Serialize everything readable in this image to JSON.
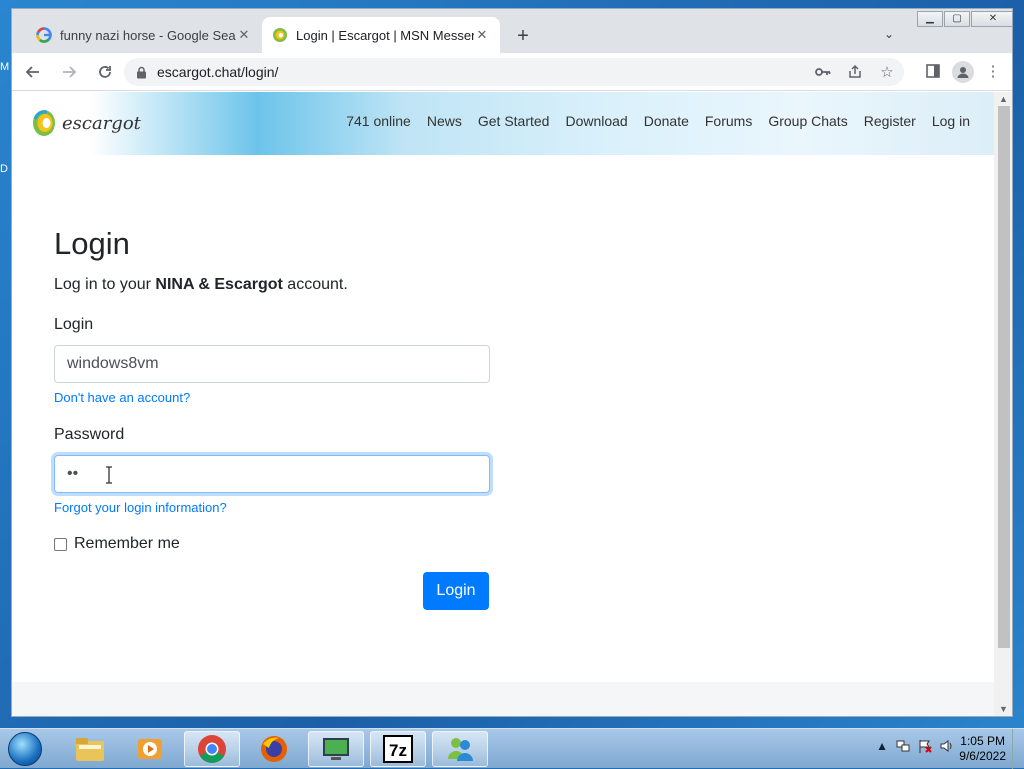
{
  "desktop": {
    "edge_letters": [
      "M",
      "D"
    ]
  },
  "browser": {
    "tabs": [
      {
        "title": "funny nazi horse - Google Search",
        "favicon": "google-g-icon",
        "active": false
      },
      {
        "title": "Login | Escargot | MSN Messenger",
        "favicon": "escargot-icon",
        "active": true
      }
    ],
    "address": "escargot.chat/login/"
  },
  "site": {
    "logo_text": "escargot",
    "nav": [
      "741 online",
      "News",
      "Get Started",
      "Download",
      "Donate",
      "Forums",
      "Group Chats",
      "Register",
      "Log in"
    ]
  },
  "form": {
    "heading": "Login",
    "lead_prefix": "Log in to your ",
    "lead_bold": "NINA & Escargot",
    "lead_suffix": " account.",
    "login_label": "Login",
    "login_value": "windows8vm",
    "no_account_link": "Don't have an account?",
    "password_label": "Password",
    "password_value": "••",
    "forgot_link": "Forgot your login information?",
    "remember_label": "Remember me",
    "submit_label": "Login"
  },
  "taskbar": {
    "time": "1:05 PM",
    "date": "9/6/2022"
  },
  "colors": {
    "primary": "#007bff",
    "link": "#007bff"
  }
}
